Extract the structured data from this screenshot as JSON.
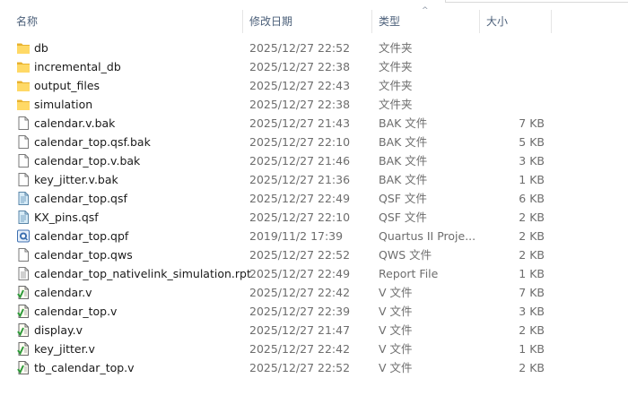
{
  "header": {
    "name": "名称",
    "date": "修改日期",
    "type": "类型",
    "size": "大小"
  },
  "files": [
    {
      "name": "db",
      "date": "2025/12/27 22:52",
      "type": "文件夹",
      "size": "",
      "icon": "folder-icon"
    },
    {
      "name": "incremental_db",
      "date": "2025/12/27 22:38",
      "type": "文件夹",
      "size": "",
      "icon": "folder-icon"
    },
    {
      "name": "output_files",
      "date": "2025/12/27 22:43",
      "type": "文件夹",
      "size": "",
      "icon": "folder-icon"
    },
    {
      "name": "simulation",
      "date": "2025/12/27 22:38",
      "type": "文件夹",
      "size": "",
      "icon": "folder-icon"
    },
    {
      "name": "calendar.v.bak",
      "date": "2025/12/27 21:43",
      "type": "BAK 文件",
      "size": "7 KB",
      "icon": "blank-file-icon"
    },
    {
      "name": "calendar_top.qsf.bak",
      "date": "2025/12/27 22:10",
      "type": "BAK 文件",
      "size": "5 KB",
      "icon": "blank-file-icon"
    },
    {
      "name": "calendar_top.v.bak",
      "date": "2025/12/27 21:46",
      "type": "BAK 文件",
      "size": "3 KB",
      "icon": "blank-file-icon"
    },
    {
      "name": "key_jitter.v.bak",
      "date": "2025/12/27 21:36",
      "type": "BAK 文件",
      "size": "1 KB",
      "icon": "blank-file-icon"
    },
    {
      "name": "calendar_top.qsf",
      "date": "2025/12/27 22:49",
      "type": "QSF 文件",
      "size": "6 KB",
      "icon": "qsf-file-icon"
    },
    {
      "name": "KX_pins.qsf",
      "date": "2025/12/27 22:10",
      "type": "QSF 文件",
      "size": "2 KB",
      "icon": "qsf-file-icon"
    },
    {
      "name": "calendar_top.qpf",
      "date": "2019/11/2 17:39",
      "type": "Quartus II Proje...",
      "size": "2 KB",
      "icon": "quartus-project-icon"
    },
    {
      "name": "calendar_top.qws",
      "date": "2025/12/27 22:52",
      "type": "QWS 文件",
      "size": "2 KB",
      "icon": "blank-file-icon"
    },
    {
      "name": "calendar_top_nativelink_simulation.rpt",
      "date": "2025/12/27 22:49",
      "type": "Report File",
      "size": "1 KB",
      "icon": "report-file-icon"
    },
    {
      "name": "calendar.v",
      "date": "2025/12/27 22:42",
      "type": "V 文件",
      "size": "7 KB",
      "icon": "verilog-file-icon"
    },
    {
      "name": "calendar_top.v",
      "date": "2025/12/27 22:39",
      "type": "V 文件",
      "size": "3 KB",
      "icon": "verilog-file-icon"
    },
    {
      "name": "display.v",
      "date": "2025/12/27 21:47",
      "type": "V 文件",
      "size": "2 KB",
      "icon": "verilog-file-icon"
    },
    {
      "name": "key_jitter.v",
      "date": "2025/12/27 22:42",
      "type": "V 文件",
      "size": "1 KB",
      "icon": "verilog-file-icon"
    },
    {
      "name": "tb_calendar_top.v",
      "date": "2025/12/27 22:52",
      "type": "V 文件",
      "size": "2 KB",
      "icon": "verilog-file-icon"
    }
  ]
}
